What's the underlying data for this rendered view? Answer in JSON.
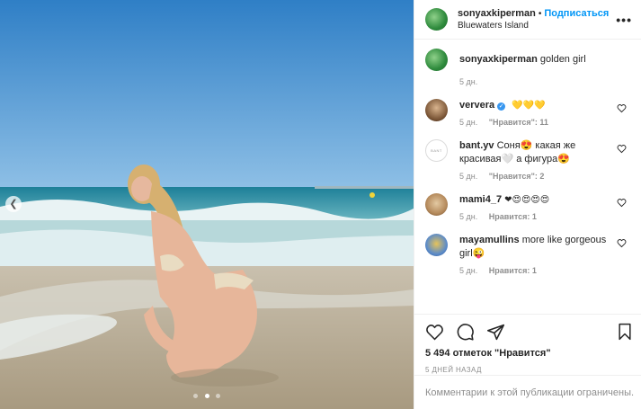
{
  "post": {
    "username": "sonyaxkiperman",
    "separator": "•",
    "follow_label": "Подписаться",
    "location": "Bluewaters Island",
    "more_label": "•••",
    "photo_index": 2,
    "photo_count": 3
  },
  "caption": {
    "username": "sonyaxkiperman",
    "text": "golden girl",
    "time": "5 дн."
  },
  "comments": [
    {
      "username": "ververa",
      "verified": true,
      "text": "💛💛💛",
      "time": "5 дн.",
      "likes": "\"Нравится\": 11",
      "reply": ""
    },
    {
      "username": "bant.yv",
      "verified": false,
      "avatar_text": "BANT",
      "text": "Соня😍 какая же красивая🤍 а фигура😍",
      "time": "5 дн.",
      "likes": "\"Нравится\": 2",
      "reply": ""
    },
    {
      "username": "mami4_7",
      "verified": false,
      "text": "❤😍😍😍😍",
      "time": "5 дн.",
      "likes": "Нравится: 1",
      "reply": ""
    },
    {
      "username": "mayamullins",
      "verified": false,
      "text": "more like gorgeous girl😜",
      "time": "5 дн.",
      "likes": "Нравится: 1",
      "reply": ""
    }
  ],
  "actions": {
    "likes_text": "5 494 отметок \"Нравится\"",
    "timestamp": "5 ДНЕЙ НАЗАД"
  },
  "footer": {
    "comments_disabled": "Комментарии к этой публикации ограничены."
  },
  "colors": {
    "accent": "#0095f6",
    "verified": "#3897f0",
    "muted": "#8e8e8e"
  },
  "icons": {
    "photo_prev": "chevron-left-icon",
    "like": "heart-icon",
    "comment": "speech-bubble-icon",
    "share": "paper-plane-icon",
    "save": "bookmark-icon"
  }
}
